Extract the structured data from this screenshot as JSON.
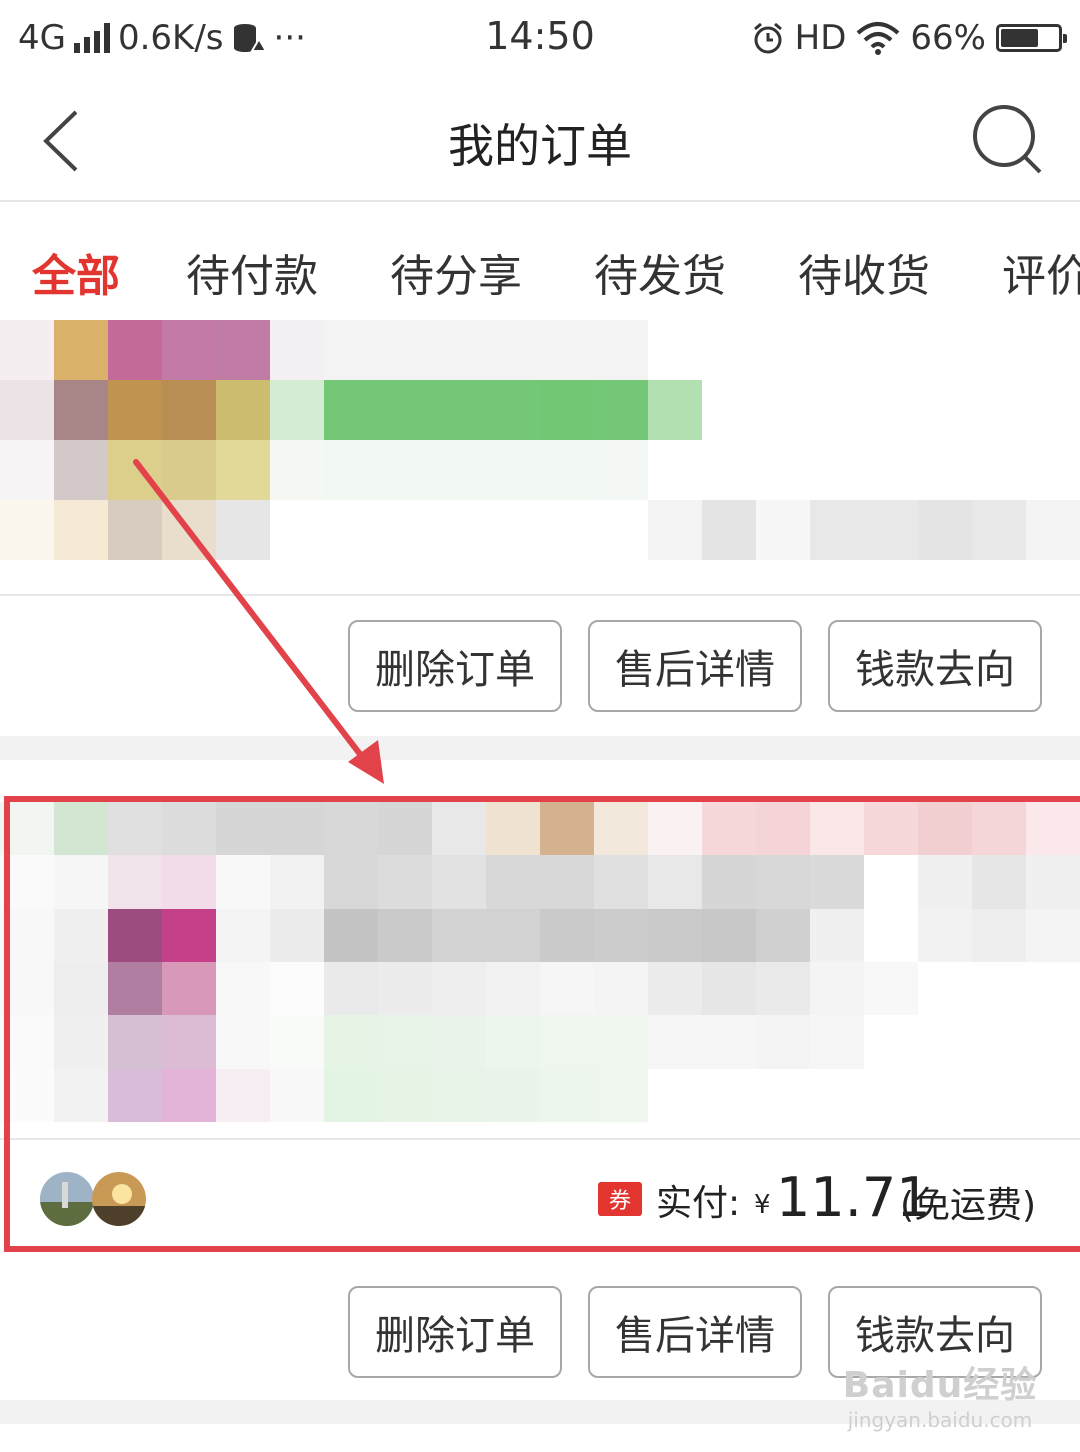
{
  "status_bar": {
    "network": "4G",
    "speed": "0.6K/s",
    "more": "···",
    "time": "14:50",
    "hd": "HD",
    "battery": "66%",
    "battery_level": 0.66
  },
  "nav": {
    "title": "我的订单"
  },
  "tabs": [
    {
      "label": "全部",
      "active": true
    },
    {
      "label": "待付款",
      "active": false
    },
    {
      "label": "待分享",
      "active": false
    },
    {
      "label": "待发货",
      "active": false
    },
    {
      "label": "待收货",
      "active": false
    },
    {
      "label": "评价",
      "active": false
    }
  ],
  "order1": {
    "buttons": [
      "删除订单",
      "售后详情",
      "钱款去向"
    ]
  },
  "order2": {
    "coupon_badge": "券",
    "paid_label": "实付:",
    "currency": "¥",
    "amount": "11.71",
    "shipping_note": "(免运费)",
    "buttons": [
      "删除订单",
      "售后详情",
      "钱款去向"
    ]
  },
  "watermark": {
    "main": "Baidu经验",
    "sub": "jingyan.baidu.com"
  },
  "colors": {
    "accent": "#e2352f",
    "highlight": "#e2434a"
  }
}
